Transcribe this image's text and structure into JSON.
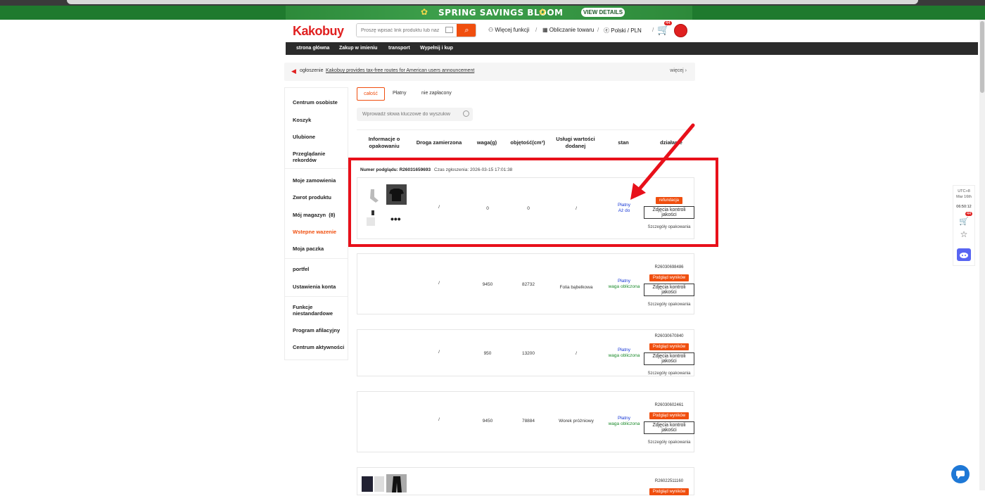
{
  "promo": {
    "title": "SPRING SAVINGS BLOOM",
    "button": "VIEW DETAILS"
  },
  "header": {
    "logo": "Kakobuy",
    "search_placeholder": "Proszę wpisać link produktu lub naz",
    "nav": [
      "Więcej funkcji",
      "Obliczanie towaru",
      "Polski / PLN"
    ],
    "cart_badge": "44"
  },
  "menubar": [
    "strona główna",
    "Zakup w imieniu",
    "transport",
    "Wypełnij i kup"
  ],
  "notice": {
    "label": "ogłoszenie",
    "text": "Kakobuy provides tax-free routes for American users announcement",
    "more": "więcej"
  },
  "sidebar": [
    "Centrum osobiste",
    "Koszyk",
    "Ulubione",
    "Przeglądanie rekordów",
    "Moje zamowienia",
    "Zwrot produktu",
    "Mój magazyn",
    "Wstepne wazenie",
    "Moja paczka",
    "portfel",
    "Ustawienia konta",
    "Funkcje niestandardowe",
    "Program afilacyjny",
    "Centrum aktywności"
  ],
  "sidebar_count": "(8)",
  "tabs": [
    "całość",
    "Płatny",
    "nie zapłacony"
  ],
  "keyword_placeholder": "Wprowadź słowa kluczowe do wyszukiw",
  "columns": [
    "Informacje o opakowaniu",
    "Droga zamierzona",
    "waga(g)",
    "objętość(cm³)",
    "Usługi wartości dodanej",
    "stan",
    "działanie"
  ],
  "first_order": {
    "preview_label": "Numer podglądu: R26031659693",
    "submit_time": "Czas zgłoszenia: 2026-03-15 17:01:38"
  },
  "orders": [
    {
      "route": "/",
      "weight": "0",
      "volume": "0",
      "service": "/",
      "status1": "Płatny",
      "status2": "Aż do",
      "number": "",
      "action1": "refundacja",
      "action2": "Zdjęcia kontroli jakości",
      "details": "Szczegóły opakowania"
    },
    {
      "route": "/",
      "weight": "9450",
      "volume": "82732",
      "service": "Folia bąbelkowa",
      "status1": "Płatny",
      "status2": "waga obliczona",
      "number": "R26030698486",
      "action1": "Podgląd wyników",
      "action2": "Zdjęcia kontroli jakości",
      "details": "Szczegóły opakowania"
    },
    {
      "route": "/",
      "weight": "950",
      "volume": "13200",
      "service": "/",
      "status1": "Płatny",
      "status2": "waga obliczona",
      "number": "R26030670840",
      "action1": "Podgląd wyników",
      "action2": "Zdjęcia kontroli jakości",
      "details": "Szczegóły opakowania"
    },
    {
      "route": "/",
      "weight": "9450",
      "volume": "78884",
      "service": "Worek próżniowy",
      "status1": "Płatny",
      "status2": "waga obliczona",
      "number": "R26030602461",
      "action1": "Podgląd wyników",
      "action2": "Zdjęcia kontroli jakości",
      "details": "Szczegóły opakowania"
    },
    {
      "route": "",
      "weight": "",
      "volume": "",
      "service": "",
      "status1": "",
      "status2": "",
      "number": "R26022511160",
      "action1": "Podgląd wyników",
      "action2": "",
      "details": ""
    }
  ],
  "right_panel": {
    "tz": "UTC+8",
    "date": "Mar 16th",
    "time": "06:50:12",
    "cart_badge": "44"
  },
  "colors": {
    "brand": "#e02020",
    "accent": "#f04e0e",
    "promo": "#1f7a2e",
    "highlight": "#e8101a"
  }
}
